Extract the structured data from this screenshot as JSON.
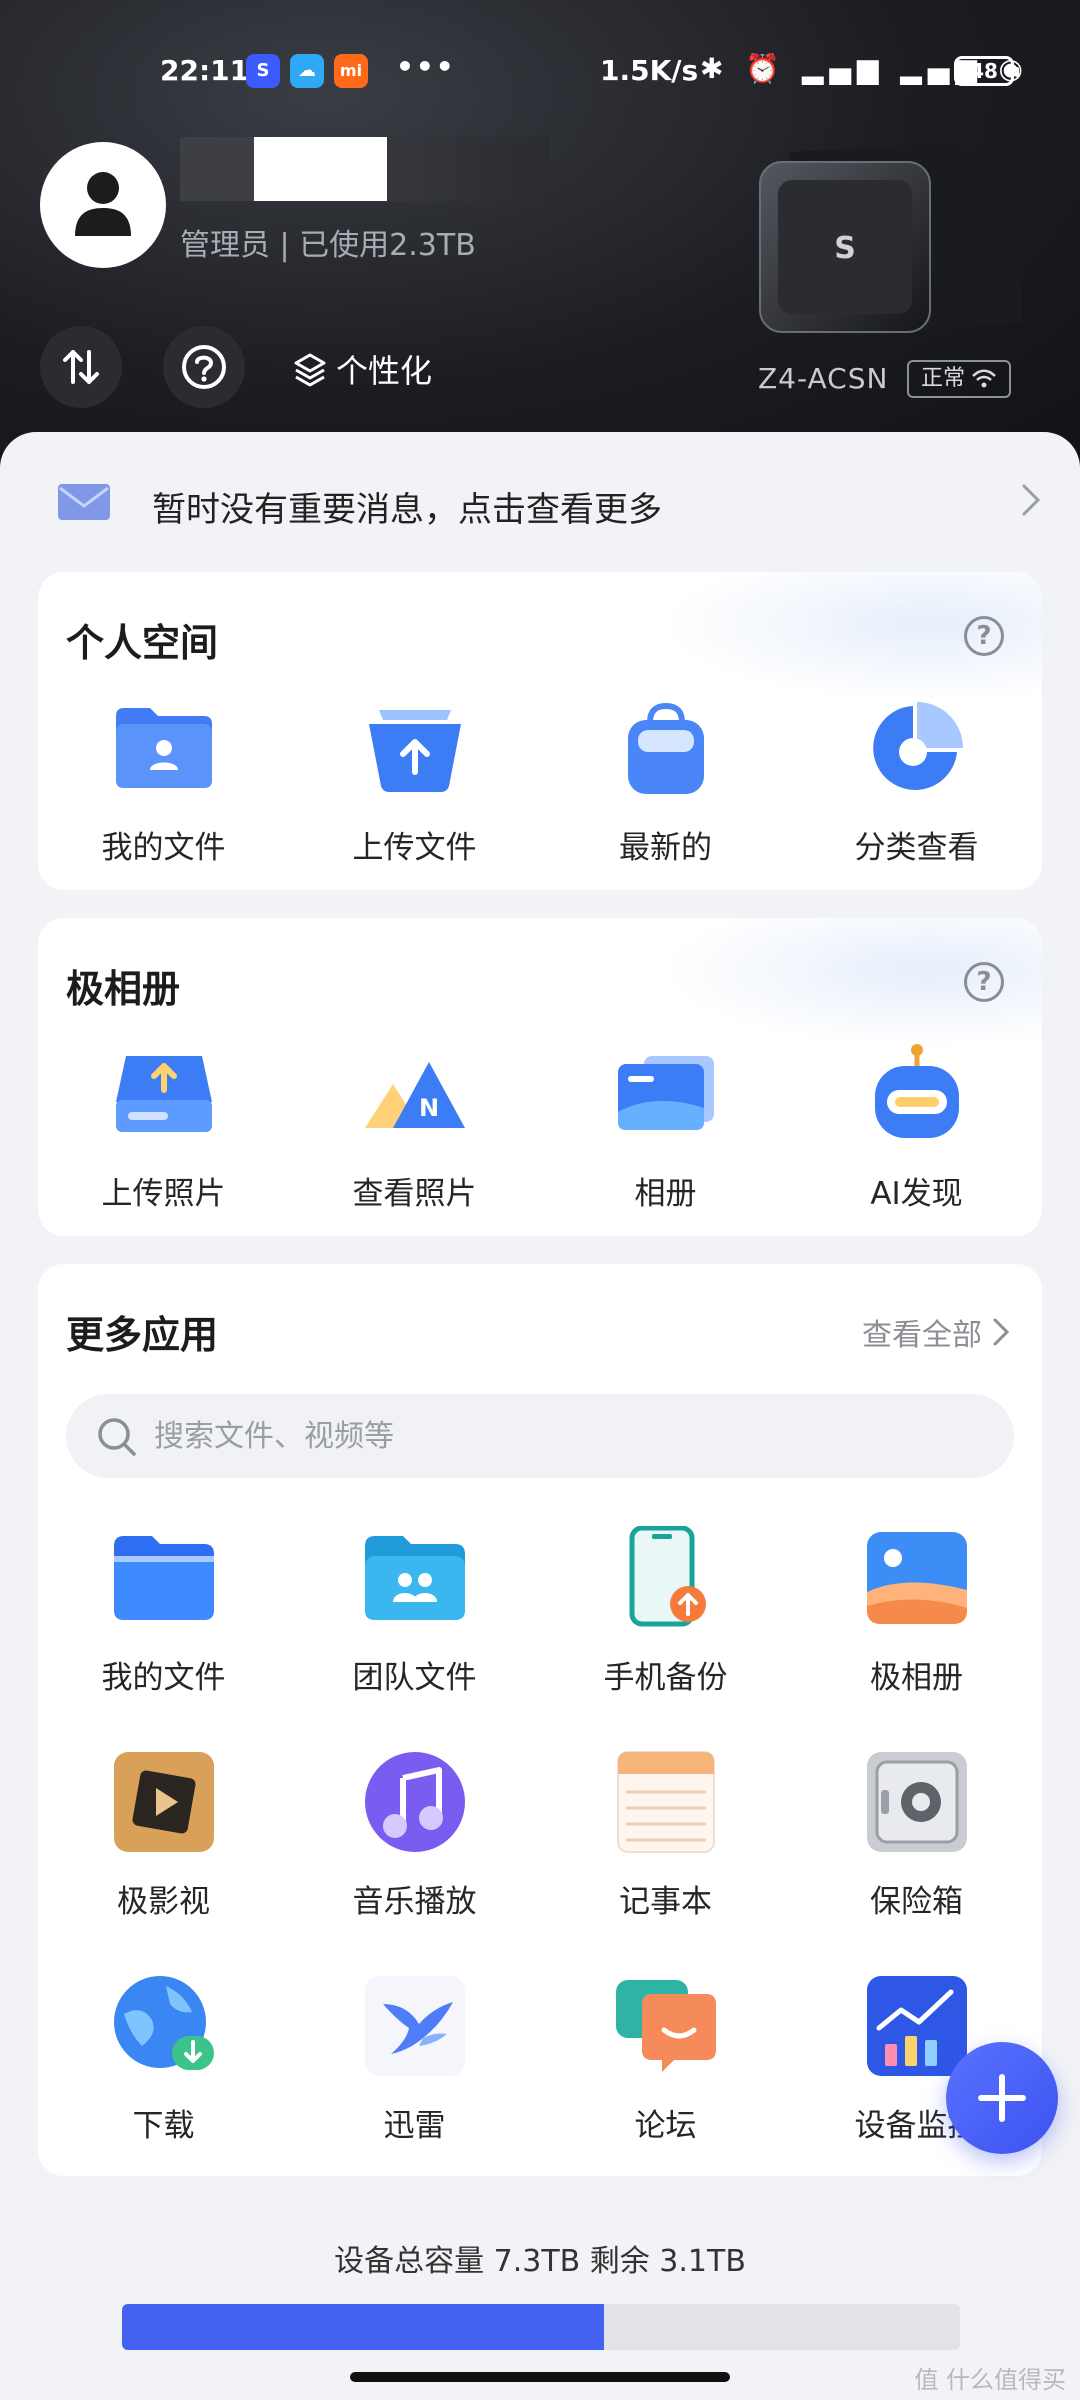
{
  "status_bar": {
    "time": "22:11",
    "app_icons": [
      "S",
      "☁",
      "mi"
    ],
    "dots": "•••",
    "net_speed": "1.5K/s",
    "right_icons": "✱ ⏰ ▂▄▆ ▂▄▆ ◉",
    "battery": "48"
  },
  "header": {
    "user_meta": "管理员 | 已使用2.3TB",
    "personalize_label": "个性化",
    "device_name": "Z4-ACSN",
    "device_status": "正常"
  },
  "message_bar": {
    "text": "暂时没有重要消息，点击查看更多"
  },
  "personal_space": {
    "title": "个人空间",
    "items": [
      {
        "label": "我的文件",
        "icon": "folder-user-icon"
      },
      {
        "label": "上传文件",
        "icon": "upload-file-icon"
      },
      {
        "label": "最新的",
        "icon": "recent-bag-icon"
      },
      {
        "label": "分类查看",
        "icon": "category-pie-icon"
      }
    ]
  },
  "album": {
    "title": "极相册",
    "items": [
      {
        "label": "上传照片",
        "icon": "upload-photo-icon"
      },
      {
        "label": "查看照片",
        "icon": "view-photos-icon"
      },
      {
        "label": "相册",
        "icon": "album-icon"
      },
      {
        "label": "AI发现",
        "icon": "ai-robot-icon"
      }
    ]
  },
  "more_apps": {
    "title": "更多应用",
    "view_all": "查看全部",
    "search_placeholder": "搜索文件、视频等",
    "rows": [
      [
        {
          "label": "我的文件",
          "icon": "my-files-icon"
        },
        {
          "label": "团队文件",
          "icon": "team-files-icon"
        },
        {
          "label": "手机备份",
          "icon": "phone-backup-icon"
        },
        {
          "label": "极相册",
          "icon": "photo-album-icon"
        }
      ],
      [
        {
          "label": "极影视",
          "icon": "video-icon"
        },
        {
          "label": "音乐播放",
          "icon": "music-icon"
        },
        {
          "label": "记事本",
          "icon": "notepad-icon"
        },
        {
          "label": "保险箱",
          "icon": "safe-icon"
        }
      ],
      [
        {
          "label": "下载",
          "icon": "download-icon"
        },
        {
          "label": "迅雷",
          "icon": "xunlei-icon"
        },
        {
          "label": "论坛",
          "icon": "forum-icon"
        },
        {
          "label": "设备监控",
          "icon": "device-monitor-icon"
        }
      ]
    ]
  },
  "capacity": {
    "text": "设备总容量 7.3TB 剩余 3.1TB",
    "used_fraction": 0.575
  },
  "watermark": "值 什么值得买",
  "colors": {
    "accent": "#4461f2",
    "header_bg": "#1c1d22",
    "page_bg": "#f2f3f7"
  }
}
